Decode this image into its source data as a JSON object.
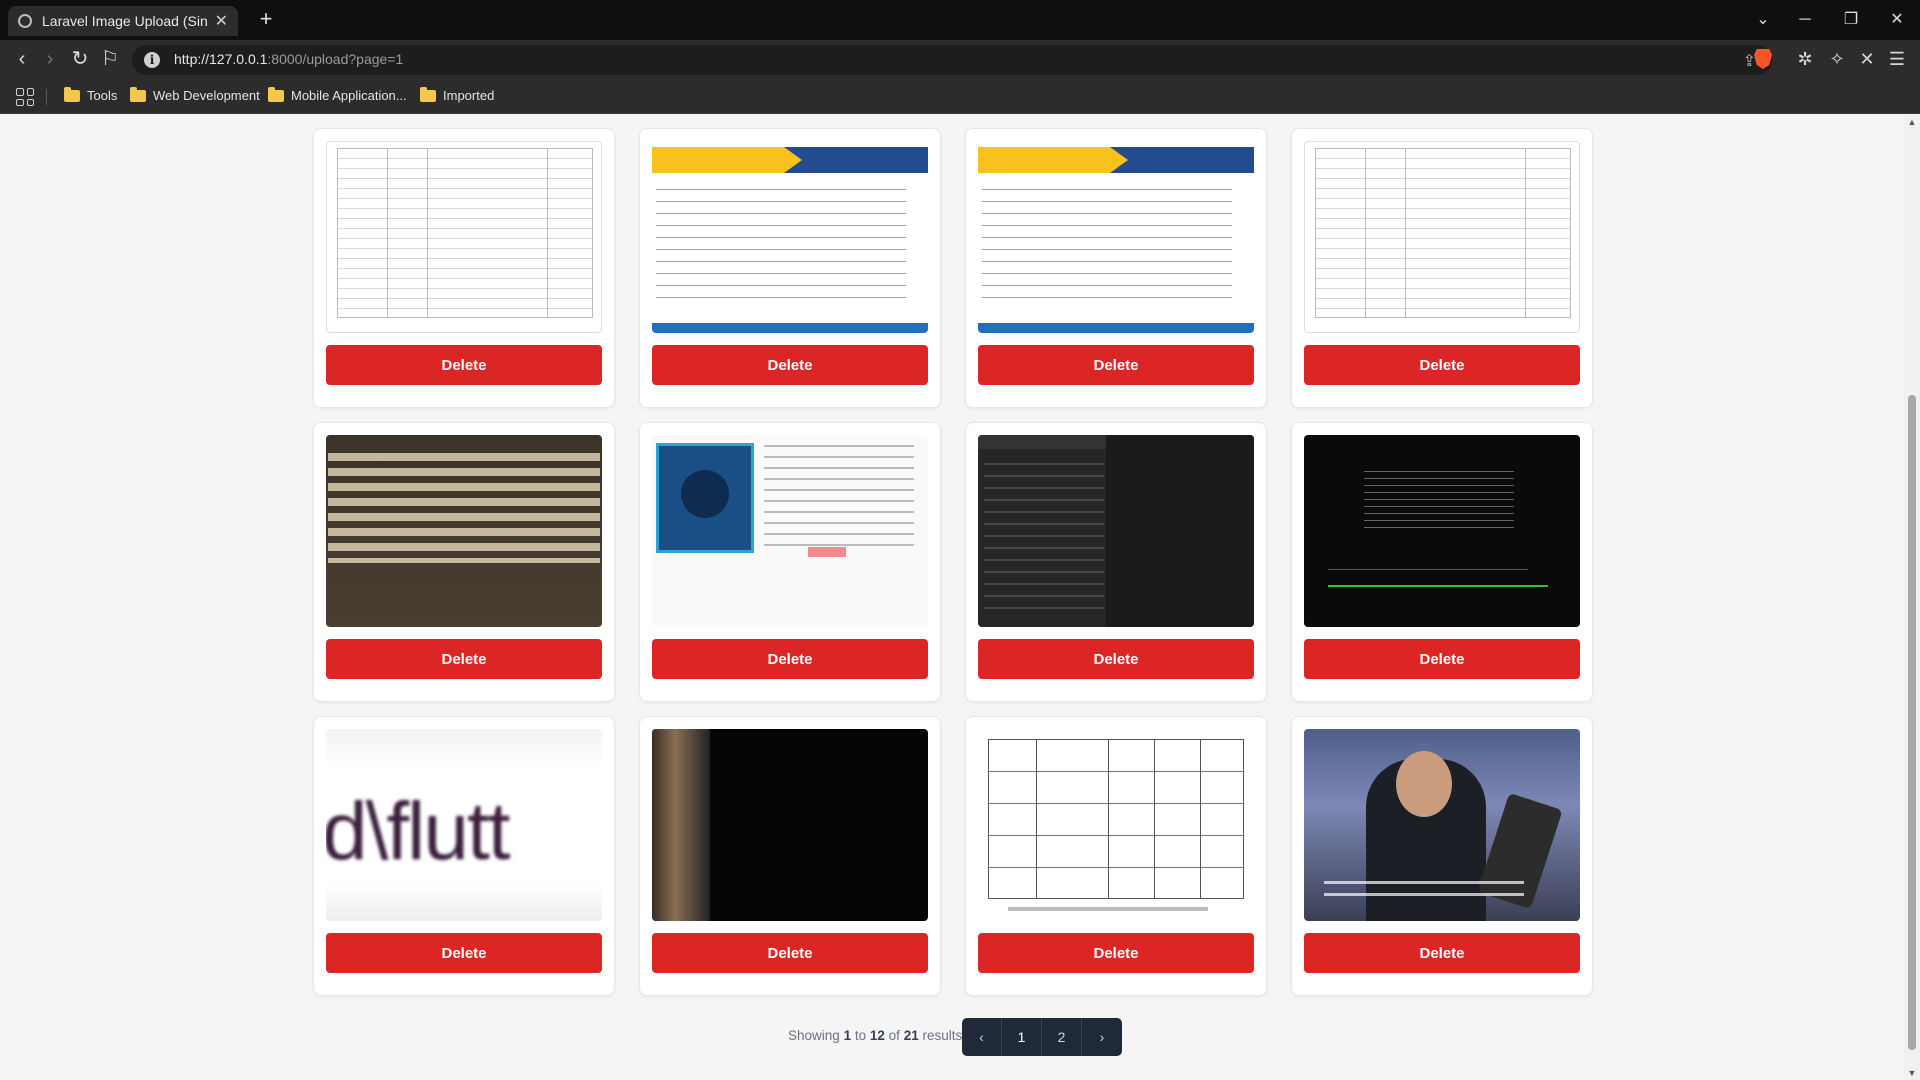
{
  "browser": {
    "tab_title": "Laravel Image Upload (Single",
    "url_host": "http://127.0.0.1",
    "url_rest": ":8000/upload?page=1",
    "bookmarks": [
      "Tools",
      "Web Development",
      "Mobile Application...",
      "Imported"
    ]
  },
  "gallery": {
    "delete_label": "Delete",
    "items": [
      {
        "kind": "document"
      },
      {
        "kind": "activity-banner"
      },
      {
        "kind": "activity-banner"
      },
      {
        "kind": "document"
      },
      {
        "kind": "text-screenshot"
      },
      {
        "kind": "store-screenshot"
      },
      {
        "kind": "windows-menu-screenshot"
      },
      {
        "kind": "terminal-screenshot"
      },
      {
        "kind": "blurred-text"
      },
      {
        "kind": "dark-photo"
      },
      {
        "kind": "table-document"
      },
      {
        "kind": "video-frame"
      }
    ]
  },
  "pagination": {
    "showing_prefix": "Showing",
    "from": "1",
    "to_word": "to",
    "to": "12",
    "of_word": "of",
    "total": "21",
    "results_word": "results",
    "prev_label": "‹",
    "pages": [
      "1",
      "2"
    ],
    "next_label": "›",
    "current_page": "1"
  },
  "colors": {
    "delete_button": "#dc2626",
    "pager_bg": "#1f2937"
  }
}
